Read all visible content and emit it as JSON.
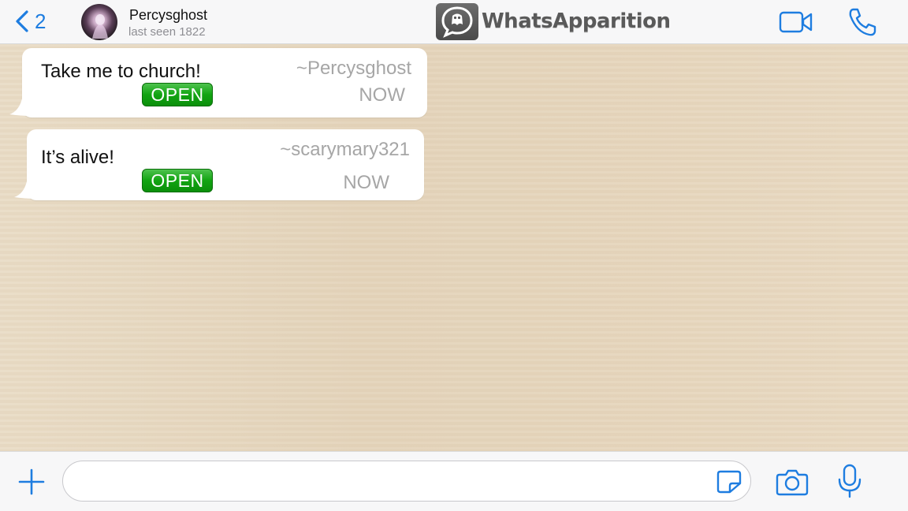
{
  "header": {
    "back_count": "2",
    "contact_name": "Percysghost",
    "last_seen_label": "last seen",
    "last_seen_value": "1822",
    "brand": "WhatsApparition"
  },
  "messages": [
    {
      "text": "Take me to church!",
      "sender": "~Percysghost",
      "time": "NOW",
      "button": "OPEN"
    },
    {
      "text": "It’s alive!",
      "sender": "~scarymary321",
      "time": "NOW",
      "button": "OPEN"
    }
  ],
  "input": {
    "placeholder": "",
    "value": ""
  },
  "colors": {
    "accent": "#1e7de0",
    "open_button": "#12a412",
    "chat_background": "#e6d7c0",
    "bubble": "#ffffff"
  },
  "icons": [
    "chevron-left-icon",
    "avatar",
    "ghost-chat-logo-icon",
    "video-camera-icon",
    "phone-icon",
    "plus-icon",
    "sticker-icon",
    "camera-icon",
    "microphone-icon"
  ]
}
